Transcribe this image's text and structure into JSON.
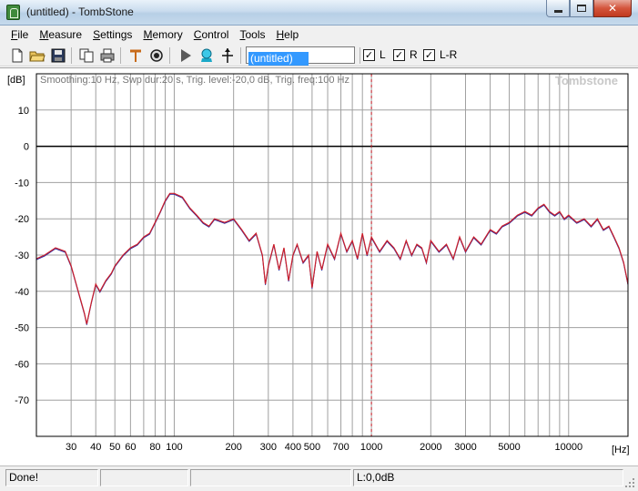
{
  "window": {
    "title": "(untitled) - TombStone"
  },
  "menu": [
    {
      "first": "F",
      "rest": "ile"
    },
    {
      "first": "M",
      "rest": "easure"
    },
    {
      "first": "S",
      "rest": "ettings"
    },
    {
      "first": "M",
      "rest": "emory"
    },
    {
      "first": "C",
      "rest": "ontrol"
    },
    {
      "first": "T",
      "rest": "ools"
    },
    {
      "first": "H",
      "rest": "elp"
    }
  ],
  "toolbar": {
    "icons": [
      "new-file-icon",
      "open-folder-icon",
      "save-icon",
      "copy-icon",
      "print-icon",
      "marker-icon",
      "microphone-icon",
      "play-icon",
      "capture-icon",
      "cursor-icon"
    ],
    "measurement_name": "(untitled)",
    "channels": [
      {
        "label": "L",
        "checked": true
      },
      {
        "label": "R",
        "checked": true
      },
      {
        "label": "L-R",
        "checked": true
      }
    ]
  },
  "graph": {
    "info": "Smoothing:10 Hz, Swp dur:20 s, Trig. level:-20,0 dB, Trig. freq:100 Hz",
    "watermark": "Tombstone",
    "y_unit": "[dB]",
    "x_unit": "[Hz]",
    "colors": {
      "curve": "#cc1f2a",
      "curve_shadow": "#2a2aa0",
      "grid": "#a0a0a0",
      "zero_line": "#000000",
      "cursor": "#cc1f2a"
    }
  },
  "chart_data": {
    "type": "line",
    "x_scale": "log",
    "xlim": [
      20,
      20000
    ],
    "ylim": [
      -80,
      20
    ],
    "grid": true,
    "yticks": [
      10,
      0,
      -10,
      -20,
      -30,
      -40,
      -50,
      -60,
      -70
    ],
    "xticks": [
      30,
      40,
      50,
      60,
      80,
      100,
      200,
      300,
      400,
      500,
      700,
      1000,
      2000,
      3000,
      5000,
      10000
    ],
    "cursor_hz": 1000,
    "series": [
      {
        "x": [
          20,
          22,
          25,
          28,
          30,
          33,
          35,
          36,
          38,
          40,
          42,
          45,
          48,
          50,
          55,
          60,
          65,
          70,
          75,
          80,
          85,
          90,
          95,
          100,
          110,
          120,
          130,
          140,
          150,
          160,
          180,
          200,
          220,
          240,
          260,
          280,
          290,
          300,
          320,
          340,
          360,
          380,
          400,
          420,
          450,
          480,
          500,
          530,
          560,
          600,
          650,
          700,
          750,
          800,
          850,
          900,
          950,
          1000,
          1100,
          1200,
          1300,
          1400,
          1500,
          1600,
          1700,
          1800,
          1900,
          2000,
          2200,
          2400,
          2600,
          2800,
          3000,
          3300,
          3600,
          4000,
          4300,
          4600,
          5000,
          5500,
          6000,
          6500,
          7000,
          7500,
          8000,
          8500,
          9000,
          9500,
          10000,
          11000,
          12000,
          13000,
          14000,
          15000,
          16000,
          17000,
          18000,
          19000,
          20000
        ],
        "y": [
          -31,
          -30,
          -28,
          -29,
          -33,
          -41,
          -46,
          -49,
          -43,
          -38,
          -40,
          -37,
          -35,
          -33,
          -30,
          -28,
          -27,
          -25,
          -24,
          -21,
          -18,
          -15,
          -13,
          -13,
          -14,
          -17,
          -19,
          -21,
          -22,
          -20,
          -21,
          -20,
          -23,
          -26,
          -24,
          -30,
          -38,
          -33,
          -27,
          -34,
          -28,
          -37,
          -30,
          -27,
          -32,
          -30,
          -39,
          -29,
          -34,
          -27,
          -31,
          -24,
          -29,
          -26,
          -31,
          -24,
          -30,
          -25,
          -29,
          -26,
          -28,
          -31,
          -26,
          -30,
          -27,
          -28,
          -32,
          -26,
          -29,
          -27,
          -31,
          -25,
          -29,
          -25,
          -27,
          -23,
          -24,
          -22,
          -21,
          -19,
          -18,
          -19,
          -17,
          -16,
          -18,
          -19,
          -18,
          -20,
          -19,
          -21,
          -20,
          -22,
          -20,
          -23,
          -22,
          -25,
          -28,
          -32,
          -38
        ]
      }
    ]
  },
  "status": {
    "message": "Done!",
    "level": "L:0,0dB"
  }
}
